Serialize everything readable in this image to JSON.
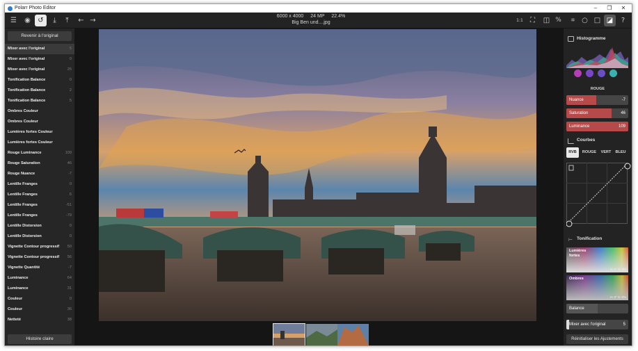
{
  "window": {
    "title": "Polarr Photo Editor",
    "minimize": "–",
    "maximize": "❐",
    "close": "✕"
  },
  "toolbar": {
    "image_dims": "6000 x 4000",
    "megapixels": "24 MP",
    "zoom": "22.4%",
    "filename": "Big Ben und....jpg",
    "fit_label": "1:1"
  },
  "left": {
    "revert_label": "Revenir à l'original",
    "history_label": "Histoire claire",
    "history": [
      {
        "label": "Mixer avec l'original",
        "value": "5"
      },
      {
        "label": "Mixer avec l'original",
        "value": "0"
      },
      {
        "label": "Mixer avec l'original",
        "value": "25"
      },
      {
        "label": "Tonification Balance",
        "value": "0"
      },
      {
        "label": "Tonification Balance",
        "value": "2"
      },
      {
        "label": "Tonification Balance",
        "value": "5"
      },
      {
        "label": "Ombres Couleur",
        "value": ""
      },
      {
        "label": "Ombres Couleur",
        "value": ""
      },
      {
        "label": "Lumières fortes Couleur",
        "value": ""
      },
      {
        "label": "Lumières fortes Couleur",
        "value": ""
      },
      {
        "label": "Rouge Luminance",
        "value": "109"
      },
      {
        "label": "Rouge Saturation",
        "value": "46"
      },
      {
        "label": "Rouge Nuance",
        "value": "-7"
      },
      {
        "label": "Lentille Franges",
        "value": "0"
      },
      {
        "label": "Lentille Franges",
        "value": "6"
      },
      {
        "label": "Lentille Franges",
        "value": "-51"
      },
      {
        "label": "Lentille Franges",
        "value": "-79"
      },
      {
        "label": "Lentille Distorsion",
        "value": "0"
      },
      {
        "label": "Lentille Distorsion",
        "value": "0"
      },
      {
        "label": "Vignette Contour progressif",
        "value": "50"
      },
      {
        "label": "Vignette Contour progressif",
        "value": "56"
      },
      {
        "label": "Vignette Quantité",
        "value": "-7"
      },
      {
        "label": "Luminance",
        "value": "64"
      },
      {
        "label": "Luminance",
        "value": "31"
      },
      {
        "label": "Couleur",
        "value": "0"
      },
      {
        "label": "Couleur",
        "value": "36"
      },
      {
        "label": "Netteté",
        "value": "38"
      }
    ]
  },
  "right": {
    "histogram_title": "Histogramme",
    "channel_label": "ROUGE",
    "hsl": [
      {
        "label": "Nuance",
        "value": "-7",
        "level": 0.48
      },
      {
        "label": "Saturation",
        "value": "46",
        "level": 0.73
      },
      {
        "label": "Luminance",
        "value": "109",
        "level": 1.0
      }
    ],
    "curves_title": "Courbes",
    "curve_tabs": [
      "RVB",
      "ROUGE",
      "VERT",
      "BLEU"
    ],
    "toning_title": "Tonification",
    "highlights_label": "Lumières fortes",
    "highlights_hs": "H: 0° S: 0%",
    "shadows_label": "Ombres",
    "shadows_hs": "H: 0° S: 0%",
    "balance_label": "Balance",
    "balance_level": 0.5,
    "mix_label": "Mixer avec l'original",
    "mix_value": "5",
    "mix_level": 0.05,
    "reset_label": "Réinitialiser les Ajustements"
  },
  "colors": {
    "accent_red": "#b64a4a",
    "panel": "#262626"
  }
}
